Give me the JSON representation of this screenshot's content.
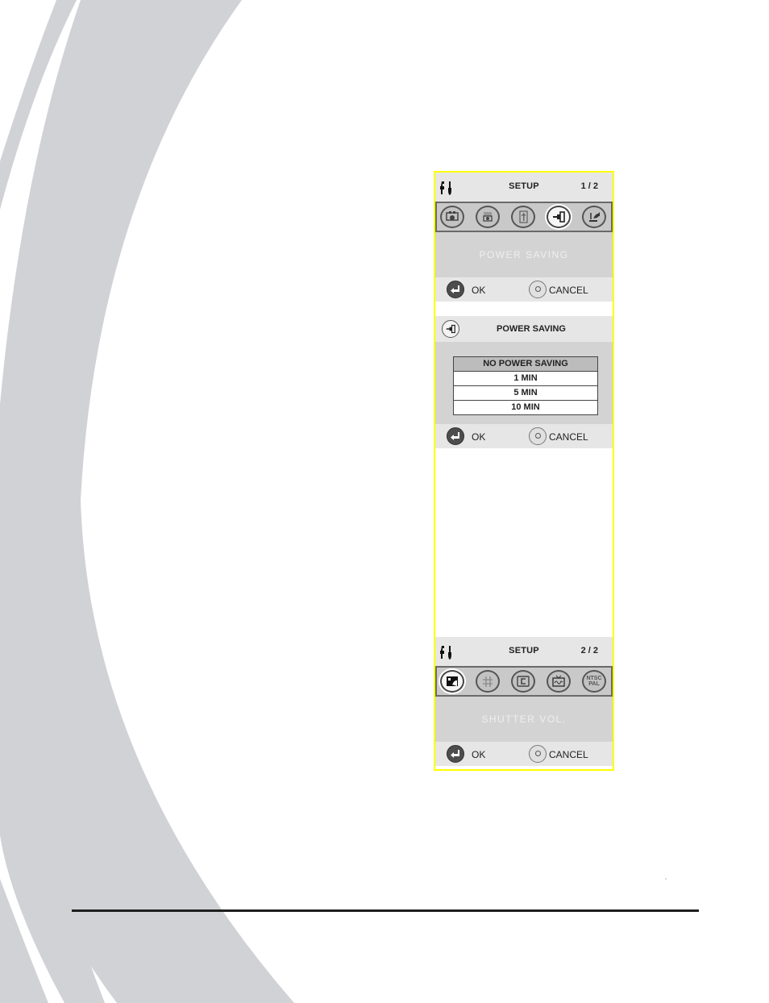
{
  "screen1": {
    "header": {
      "title": "SETUP",
      "page": "1 / 2",
      "icon": "tools-icon"
    },
    "icons": [
      {
        "name": "movie-mode-icon",
        "selected": false
      },
      {
        "name": "photo-mode-icon",
        "selected": false
      },
      {
        "name": "memory-card-icon",
        "selected": false
      },
      {
        "name": "power-saving-icon",
        "selected": true
      },
      {
        "name": "sound-icon",
        "selected": false
      }
    ],
    "description": "POWER SAVING",
    "buttons": {
      "ok": "OK",
      "cancel": "CANCEL"
    }
  },
  "screen2": {
    "header": {
      "title": "POWER SAVING",
      "icon": "power-saving-icon"
    },
    "options": [
      "NO POWER SAVING",
      "1  MIN",
      "5  MIN",
      "10  MIN"
    ],
    "selected_option": "NO POWER SAVING",
    "buttons": {
      "ok": "OK",
      "cancel": "CANCEL"
    }
  },
  "screen3": {
    "header": {
      "title": "SETUP",
      "page": "2 / 2",
      "icon": "tools-icon"
    },
    "icons": [
      {
        "name": "shutter-volume-icon",
        "selected": true
      },
      {
        "name": "language-icon",
        "selected": false
      },
      {
        "name": "format-icon",
        "selected": false
      },
      {
        "name": "tv-out-icon",
        "selected": false
      },
      {
        "name": "ntsc-pal-icon",
        "selected": false,
        "text": "NTSC\nPAL"
      }
    ],
    "description": "SHUTTER VOL.",
    "buttons": {
      "ok": "OK",
      "cancel": "CANCEL"
    }
  },
  "colors": {
    "panel_border": "#ffff00",
    "header_bg": "#e6e6e6",
    "description_bg": "#d3d3d3",
    "background_arcs": "#d1d2d6"
  }
}
